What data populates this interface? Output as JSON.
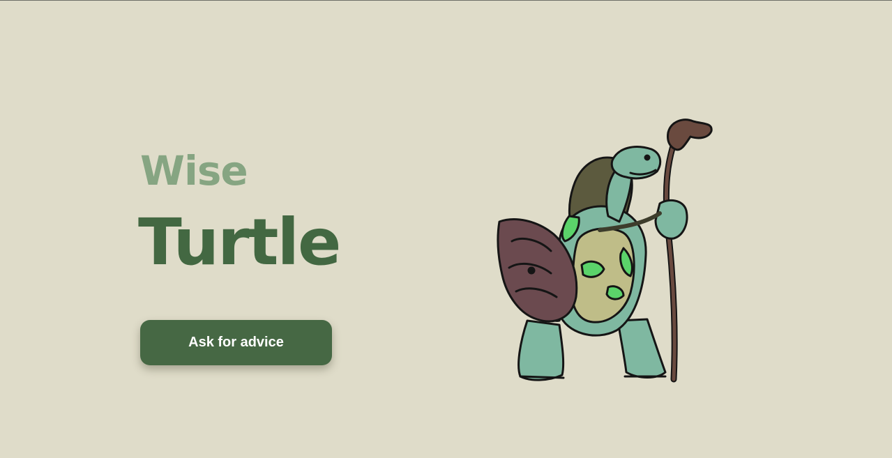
{
  "hero": {
    "subtitle": "Wise",
    "title": "Turtle",
    "cta_label": "Ask for advice"
  },
  "illustration": {
    "icon": "turtle-sage-with-staff-icon"
  },
  "colors": {
    "background": "#dfdcc9",
    "subtitle": "#86a582",
    "title": "#436842",
    "button": "#466844",
    "button_text": "#ffffff"
  }
}
